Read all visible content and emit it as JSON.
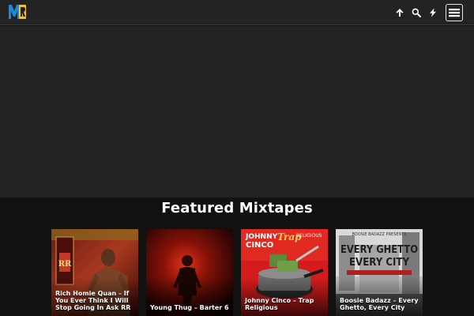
{
  "header": {
    "logo_text": "MR",
    "icons": [
      "up-arrow-icon",
      "search-icon",
      "lightning-icon",
      "hamburger-menu-icon"
    ]
  },
  "featured": {
    "title": "Featured Mixtapes",
    "items": [
      {
        "title": "Rich Homie Quan – If You Ever Think I Will Stop Going In Ask RR",
        "cover_text": "RR"
      },
      {
        "title": "Young Thug – Barter 6",
        "cover_text": ""
      },
      {
        "title": "Johnny Cinco – Trap Religious",
        "cover_text": "JOHNNY CINCO TRAP RELIGIOUS"
      },
      {
        "title": "Boosie Badazz – Every Ghetto, Every City",
        "cover_text": "EVERY GHETTO EVERY CITY"
      }
    ]
  },
  "colors": {
    "header_bg": "#232323",
    "page_bg": "#111111",
    "logo_blue": "#1e88d8",
    "logo_yellow": "#f2c12e"
  }
}
